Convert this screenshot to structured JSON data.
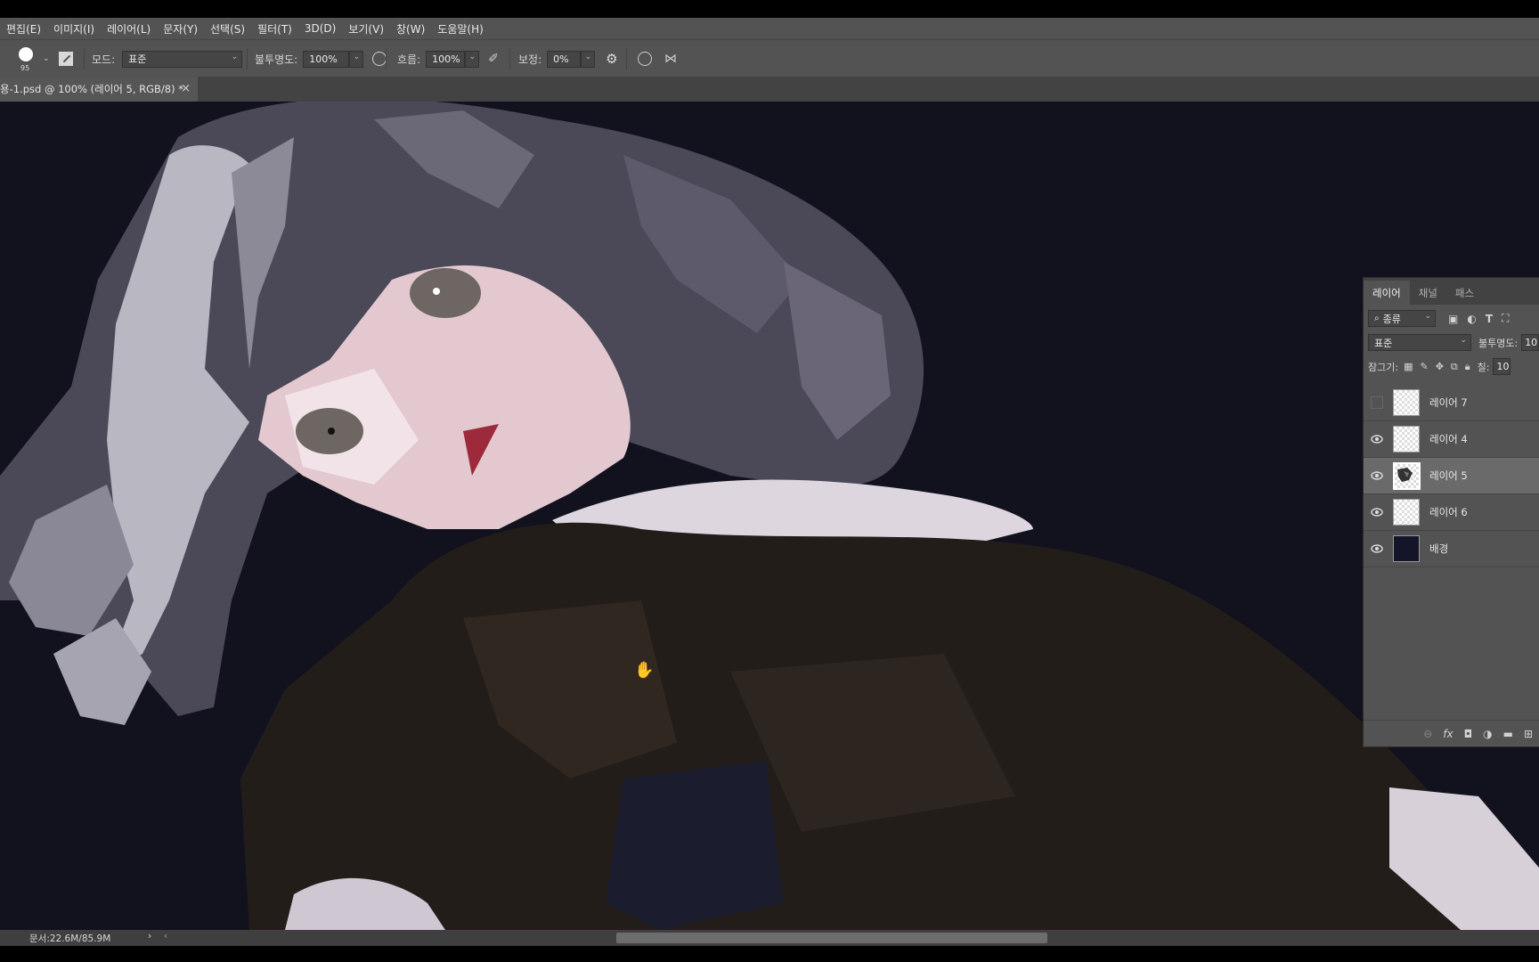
{
  "menu": [
    "편집(E)",
    "이미지(I)",
    "레이어(L)",
    "문자(Y)",
    "선택(S)",
    "필터(T)",
    "3D(D)",
    "보기(V)",
    "창(W)",
    "도움말(H)"
  ],
  "options": {
    "brush_size": "95",
    "mode_label": "모드:",
    "mode_value": "표준",
    "opacity_label": "불투명도:",
    "opacity_value": "100%",
    "flow_label": "흐름:",
    "flow_value": "100%",
    "smoothing_label": "보정:",
    "smoothing_value": "0%"
  },
  "document": {
    "tab_title": "용-1.psd @ 100% (레이어 5, RGB/8) *",
    "close": "×"
  },
  "status": {
    "doc_size": "문서:22.6M/85.9M"
  },
  "layers_panel": {
    "tabs": [
      "레이어",
      "채널",
      "패스"
    ],
    "filter_kind": "종류",
    "blend_mode": "표준",
    "opacity_label": "불투명도:",
    "opacity_value": "10",
    "lock_label": "잠그기:",
    "fill_label": "칠:",
    "fill_value": "10",
    "layers": [
      {
        "name": "레이어 7",
        "visible": false,
        "selected": false,
        "thumb": "transparent"
      },
      {
        "name": "레이어 4",
        "visible": true,
        "selected": false,
        "thumb": "transparent"
      },
      {
        "name": "레이어 5",
        "visible": true,
        "selected": true,
        "thumb": "sketch"
      },
      {
        "name": "레이어 6",
        "visible": true,
        "selected": false,
        "thumb": "transparent"
      },
      {
        "name": "배경",
        "visible": true,
        "selected": false,
        "thumb": "dark"
      }
    ]
  },
  "colors": {
    "canvas_bg": "#12121f",
    "panel": "#535353",
    "ui_dark": "#434343"
  }
}
